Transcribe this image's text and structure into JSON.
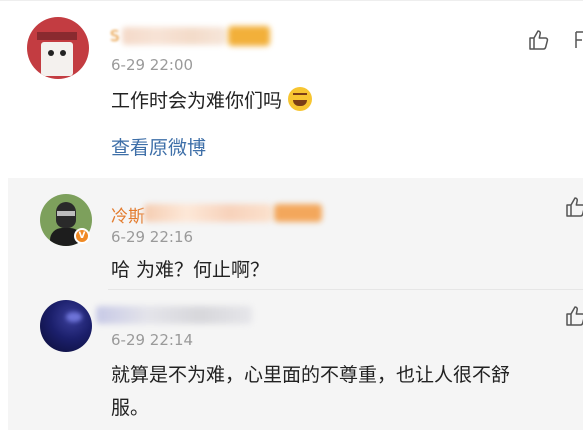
{
  "main_comment": {
    "username_visible_char": "S",
    "time": "6-29 22:00",
    "text": "工作时会为难你们吗",
    "emoji": "laughing-tears",
    "view_original_link": "查看原微博"
  },
  "replies": [
    {
      "username_visible_prefix": "冷斯",
      "verified_badge": "V",
      "time": "6-29 22:16",
      "text": "哈 为难？何止啊？"
    },
    {
      "time": "6-29 22:14",
      "text_line1": "就算是不为难，心里面的不尊重，也让人很不舒",
      "text_line2": "服。"
    }
  ],
  "colors": {
    "link": "#3e6fa8",
    "username_orange": "#e37b2d",
    "timestamp": "#9a9a9a",
    "reply_bg": "#f5f5f5"
  }
}
